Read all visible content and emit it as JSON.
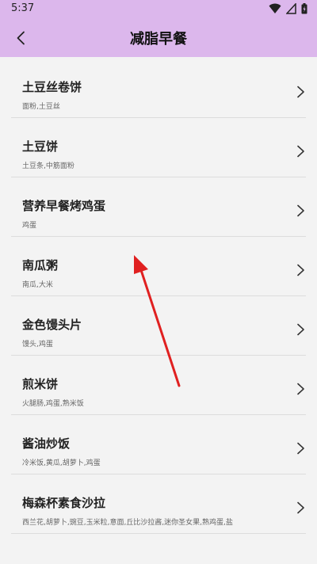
{
  "status_bar": {
    "time": "5:37"
  },
  "header": {
    "title": "减脂早餐",
    "background_color": "#dcb7ec"
  },
  "annotation": {
    "color": "#e02020"
  },
  "list": {
    "items": [
      {
        "title": "土豆丝卷饼",
        "ingredients": "面粉,土豆丝"
      },
      {
        "title": "土豆饼",
        "ingredients": "土豆条,中筋面粉"
      },
      {
        "title": "营养早餐烤鸡蛋",
        "ingredients": "鸡蛋"
      },
      {
        "title": "南瓜粥",
        "ingredients": "南瓜,大米"
      },
      {
        "title": "金色馒头片",
        "ingredients": "馒头,鸡蛋"
      },
      {
        "title": "煎米饼",
        "ingredients": "火腿肠,鸡蛋,熟米饭"
      },
      {
        "title": "酱油炒饭",
        "ingredients": "冷米饭,黄瓜,胡萝卜,鸡蛋"
      },
      {
        "title": "梅森杯素食沙拉",
        "ingredients": "西兰花,胡萝卜,豌豆,玉米粒,意面,丘比沙拉酱,迷你圣女果,熟鸡蛋,盐"
      }
    ]
  }
}
